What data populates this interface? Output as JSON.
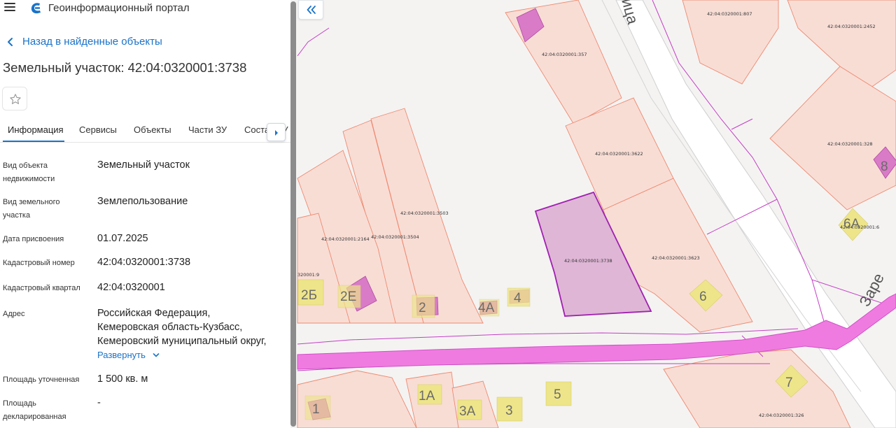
{
  "header": {
    "title": "Геоинформационный портал",
    "menu_icon": "hamburger-icon",
    "logo_icon": "portal-logo-icon"
  },
  "nav": {
    "back_label": "Назад в найденные объекты"
  },
  "object": {
    "title": "Земельный участок: 42:04:0320001:3738",
    "favorite_icon": "star-icon"
  },
  "tabs": [
    {
      "label": "Информация",
      "active": true
    },
    {
      "label": "Сервисы"
    },
    {
      "label": "Объекты"
    },
    {
      "label": "Части ЗУ"
    },
    {
      "label": "Состав ЗУ"
    }
  ],
  "properties": [
    {
      "label": "Вид объекта недвижимости",
      "value": "Земельный участок"
    },
    {
      "label": "Вид земельного участка",
      "value": "Землепользование"
    },
    {
      "label": "Дата присвоения",
      "value": "01.07.2025"
    },
    {
      "label": "Кадастровый номер",
      "value": "42:04:0320001:3738"
    },
    {
      "label": "Кадастровый квартал",
      "value": "42:04:0320001"
    },
    {
      "label": "Адрес",
      "value_lines": [
        "Российская Федерация,",
        "Кемеровская область-Кузбасс,",
        "Кемеровский муниципальный округ,"
      ]
    },
    {
      "label": "Площадь уточненная",
      "value": "1 500 кв. м"
    },
    {
      "label": "Площадь декларированная",
      "value": "-"
    }
  ],
  "expand_label": "Развернуть",
  "map": {
    "parcel_labels": {
      "p357": "42:04:0320001:357",
      "p807": "42:04:0320001:807",
      "p2452": "42:04:0320001:2452",
      "p3622": "42:04:0320001:3622",
      "p328": "42:04:0320001:328",
      "p3503": "42:04:0320001:3503",
      "p2164": "42:04:0320001:2164",
      "p3504": "42:04:0320001:3504",
      "p3738": "42:04:0320001:3738",
      "p3623": "42:04:0320001:3623",
      "p6": "42:04:0320001:6",
      "p9": "320001:9",
      "p326": "42:04:0320001:326"
    },
    "house_numbers": {
      "h2b": "2Б",
      "h2e": "2Е",
      "h2": "2",
      "h4a": "4А",
      "h4": "4",
      "h6": "6",
      "h8": "8",
      "h6a": "6А",
      "h1": "1",
      "h1a": "1А",
      "h3a": "3А",
      "h3": "3",
      "h5": "5",
      "h7": "7"
    },
    "streets": {
      "top": "ица",
      "right": "Заре"
    },
    "colors": {
      "selected_fill": "#dfb6d6",
      "selected_stroke": "#a020b0",
      "parcel_fill": "#f8ddd5",
      "parcel_stroke": "#ee8a70",
      "road": "#f07be0",
      "boundary": "#c43fc4"
    },
    "collapse_icon": "double-chevron-left-icon"
  }
}
